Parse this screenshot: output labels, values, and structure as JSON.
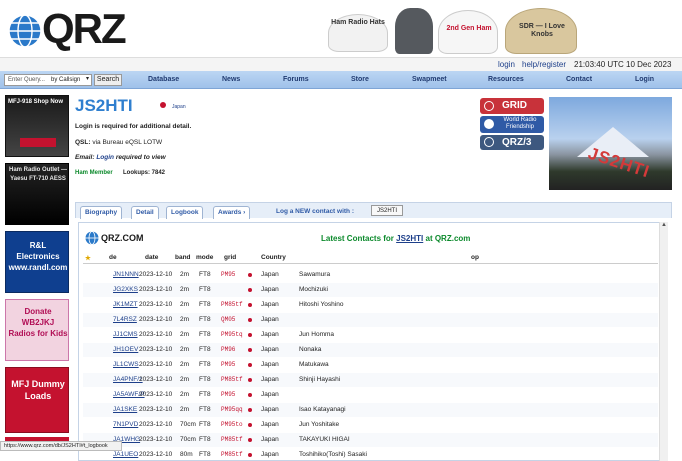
{
  "header": {
    "logo_text": "QRZ",
    "ads": [
      "Ham Radio Hats",
      "2nd Gen Ham",
      "SDR — I Love Knobs"
    ]
  },
  "toprow": {
    "login": "login",
    "register": "help/register",
    "time": "21:03:40 UTC 10 Dec 2023"
  },
  "search": {
    "placeholder": "Enter Query...",
    "mode": "by Callsign",
    "button": "Search"
  },
  "nav": [
    "Database",
    "News",
    "Forums",
    "Store",
    "Swapmeet",
    "Resources",
    "Contact",
    "Login"
  ],
  "sidebar_ads": [
    "MFJ-918 Shop Now",
    "Ham Radio Outlet — Yaesu FT-710 AESS",
    "R&L Electronics www.randl.com",
    "Donate WB2JKJ Radios for Kids",
    "MFJ Dummy Loads"
  ],
  "profile": {
    "callsign": "JS2HTI",
    "country": "Japan",
    "login_note": "Login is required for additional detail.",
    "qsl_label": "QSL:",
    "qsl_value": "via Bureau eQSL LOTW",
    "email_label": "Email:",
    "email_link": "Login",
    "email_suffix": "required to view",
    "member": "Ham Member",
    "lookups_label": "Lookups:",
    "lookups": "7842",
    "photo_text": "JS2HTI"
  },
  "buttons": {
    "grid": "GRID",
    "wrf": "World Radio Friendship",
    "qrz3": "QRZ/3"
  },
  "tabs": [
    "Biography",
    "Detail",
    "Logbook",
    "Awards ›"
  ],
  "log_new": {
    "label": "Log a NEW contact with :",
    "value": "JS2HTI"
  },
  "logbook": {
    "brand": "QRZ.COM",
    "title_prefix": "Latest Contacts for",
    "title_call": "JS2HTI",
    "title_suffix": "at QRZ.com",
    "headers": [
      "de",
      "date",
      "band",
      "mode",
      "grid",
      "Country",
      "op"
    ],
    "rows": [
      {
        "call": "JN1NNN",
        "date": "2023-12-10",
        "band": "2m",
        "mode": "FT8",
        "grid": "PM95",
        "country": "Japan",
        "op": "Sawamura"
      },
      {
        "call": "JG2XKS",
        "date": "2023-12-10",
        "band": "2m",
        "mode": "FT8",
        "grid": "",
        "country": "Japan",
        "op": "Mochizuki"
      },
      {
        "call": "JK1MZT",
        "date": "2023-12-10",
        "band": "2m",
        "mode": "FT8",
        "grid": "PM85tf",
        "country": "Japan",
        "op": "Hitoshi Yoshino"
      },
      {
        "call": "7L4RSZ",
        "date": "2023-12-10",
        "band": "2m",
        "mode": "FT8",
        "grid": "QM05",
        "country": "Japan",
        "op": ""
      },
      {
        "call": "JJ1CMS",
        "date": "2023-12-10",
        "band": "2m",
        "mode": "FT8",
        "grid": "PM95tq",
        "country": "Japan",
        "op": "Jun Homma"
      },
      {
        "call": "JH1OEV",
        "date": "2023-12-10",
        "band": "2m",
        "mode": "FT8",
        "grid": "PM96",
        "country": "Japan",
        "op": "Nonaka"
      },
      {
        "call": "JL1CWS",
        "date": "2023-12-10",
        "band": "2m",
        "mode": "FT8",
        "grid": "PM95",
        "country": "Japan",
        "op": "Matukawa"
      },
      {
        "call": "JA4PNF/1",
        "date": "2023-12-10",
        "band": "2m",
        "mode": "FT8",
        "grid": "PM85tf",
        "country": "Japan",
        "op": "Shinji Hayashi"
      },
      {
        "call": "JA5AWF/P",
        "date": "2023-12-10",
        "band": "2m",
        "mode": "FT8",
        "grid": "PM95",
        "country": "Japan",
        "op": ""
      },
      {
        "call": "JA1SKE",
        "date": "2023-12-10",
        "band": "2m",
        "mode": "FT8",
        "grid": "PM95qq",
        "country": "Japan",
        "op": "Isao Katayanagi"
      },
      {
        "call": "7N1PVD",
        "date": "2023-12-10",
        "band": "70cm",
        "mode": "FT8",
        "grid": "PM95to",
        "country": "Japan",
        "op": "Jun Yoshitake"
      },
      {
        "call": "JA1WHG",
        "date": "2023-12-10",
        "band": "70cm",
        "mode": "FT8",
        "grid": "PM85tf",
        "country": "Japan",
        "op": "TAKAYUKI HIGAI"
      },
      {
        "call": "JA1UEO",
        "date": "2023-12-10",
        "band": "80m",
        "mode": "FT8",
        "grid": "PM85tf",
        "country": "Japan",
        "op": "Toshihiko(Toshi) Sasaki"
      }
    ]
  },
  "status_url": "https://www.qrz.com/db/JS2HTI#t_logbook"
}
